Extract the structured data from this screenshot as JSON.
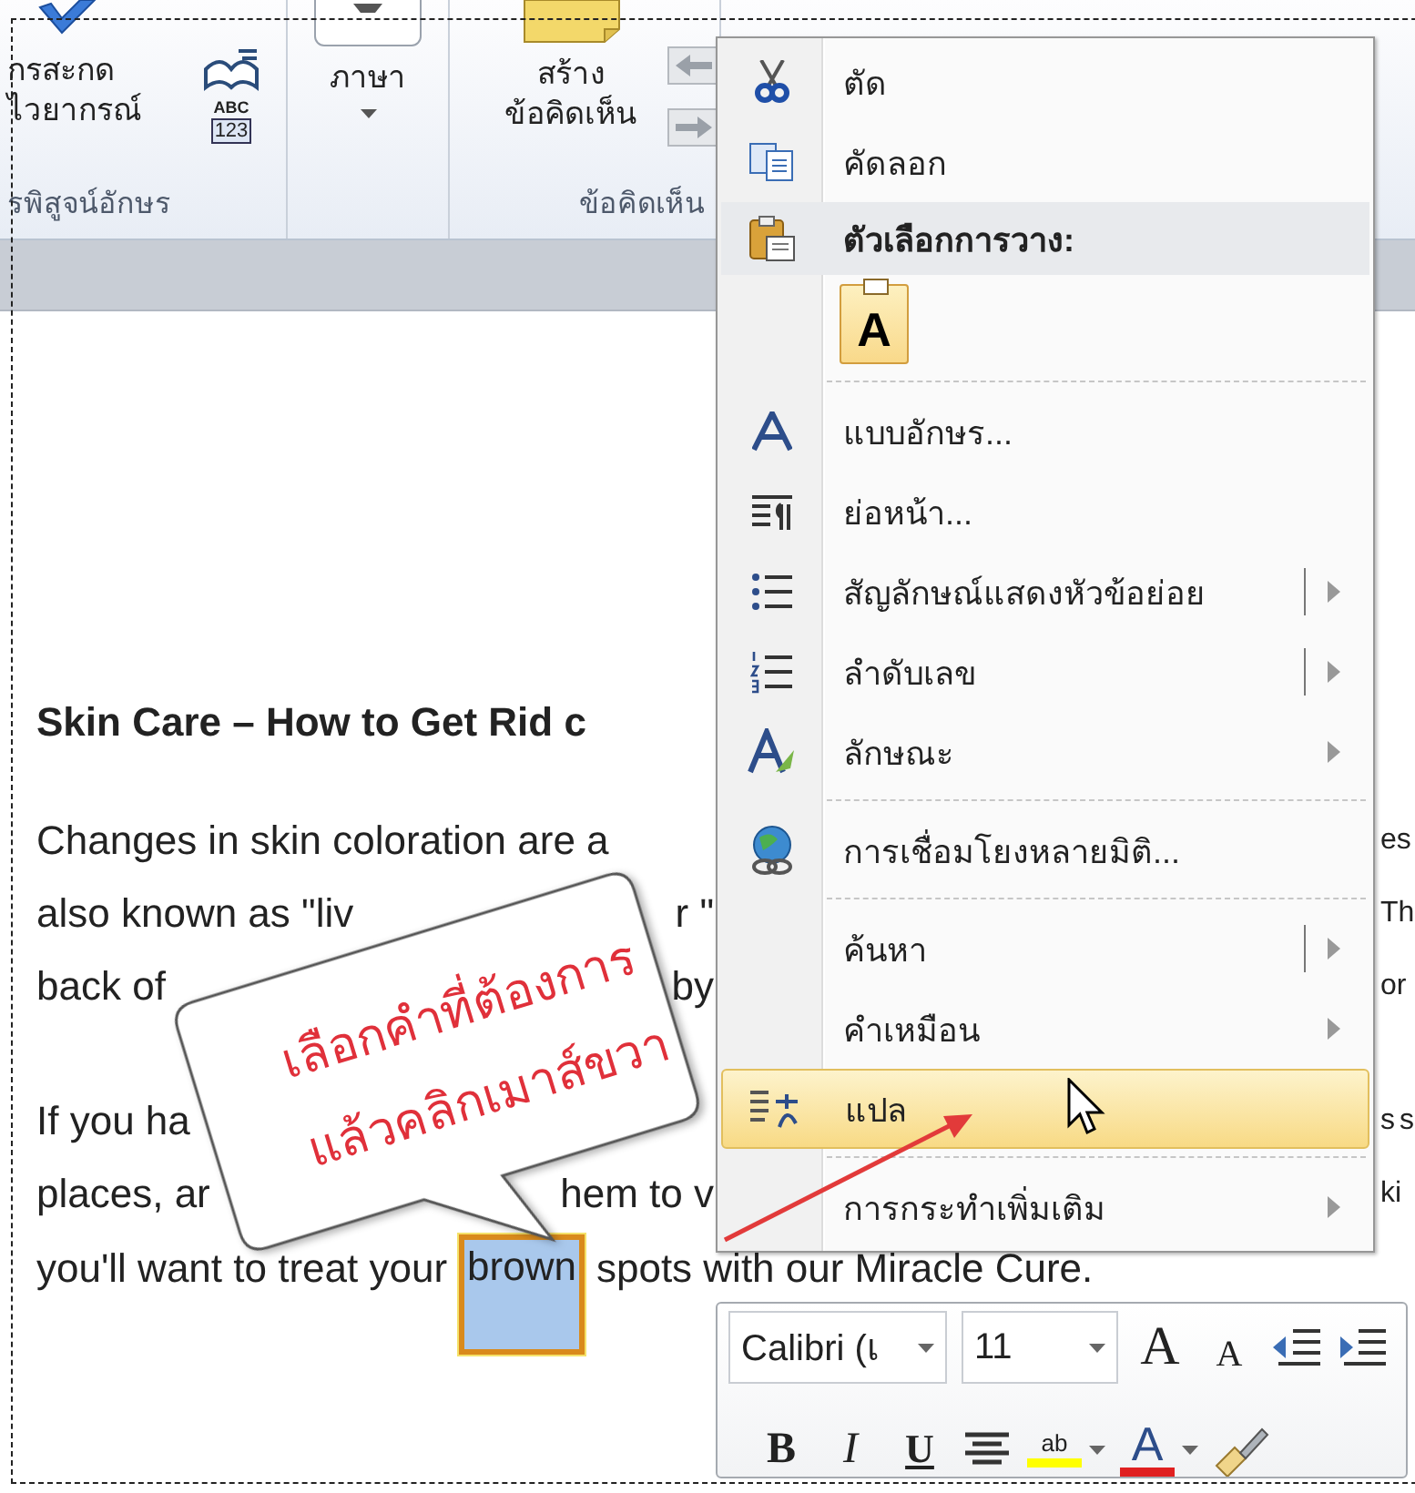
{
  "ribbon": {
    "groups": [
      {
        "label": "รพิสูจน์อักษร",
        "buttons": [
          {
            "kind": "large",
            "lines": [
              "กรสะกด",
              "ไวยากรณ์"
            ]
          },
          {
            "kind": "word_count",
            "lines": [
              "ABC",
              "123"
            ]
          }
        ]
      },
      {
        "buttons": [
          {
            "kind": "dropdown",
            "lines": [
              "ภาษา"
            ]
          }
        ]
      },
      {
        "label": "ข้อคิดเห็น",
        "buttons": [
          {
            "kind": "large",
            "lines": [
              "สร้าง",
              "ข้อคิดเห็น"
            ]
          },
          {
            "kind": "nav"
          }
        ]
      }
    ]
  },
  "document": {
    "heading": "Skin Care – How to Get Rid c",
    "paragraphs": [
      [
        {
          "kind": "cut",
          "left": "Changes in skin coloration are a",
          "right": "es"
        },
        {
          "kind": "cut",
          "left": "also known as \"liv",
          "middle": "r \"",
          "right": "Th"
        },
        {
          "kind": "cut",
          "left": "back of",
          "middle": "by",
          "right": "or"
        }
      ],
      [
        {
          "kind": "cut",
          "left": "If you ha",
          "right": "s s"
        },
        {
          "kind": "cut",
          "left": "places, ar",
          "middle": "hem to v",
          "right": "ki"
        },
        {
          "kind": "full",
          "segments": [
            {
              "text": "you'll want to treat your",
              "selected": false
            },
            {
              "text": "brown",
              "selected": true
            },
            {
              "text": "spots with our Miracle Cure.",
              "selected": false
            }
          ]
        }
      ]
    ]
  },
  "context_menu": [
    {
      "kind": "item",
      "label": "ตัด",
      "selected": false
    },
    {
      "kind": "item",
      "label": "คัดลอก",
      "selected": false
    },
    {
      "kind": "header",
      "label": "ตัวเลือกการวาง:"
    },
    {
      "kind": "paste_option",
      "label": "A"
    },
    {
      "kind": "separator"
    },
    {
      "kind": "item",
      "label": "แบบอักษร...",
      "selected": false
    },
    {
      "kind": "item",
      "label": "ย่อหน้า...",
      "selected": false
    },
    {
      "kind": "item",
      "label": "สัญลักษณ์แสดงหัวข้อย่อย",
      "submenu": true,
      "split": true,
      "selected": false
    },
    {
      "kind": "item",
      "label": "ลำดับเลข",
      "submenu": true,
      "split": true,
      "selected": false
    },
    {
      "kind": "item",
      "label": "ลักษณะ",
      "submenu": true,
      "selected": false
    },
    {
      "kind": "separator"
    },
    {
      "kind": "item",
      "label": "การเชื่อมโยงหลายมิติ...",
      "selected": false
    },
    {
      "kind": "separator"
    },
    {
      "kind": "item",
      "label": "ค้นหา",
      "submenu": true,
      "split": true,
      "selected": false
    },
    {
      "kind": "item",
      "label": "คำเหมือน",
      "submenu": true,
      "selected": false
    },
    {
      "kind": "item",
      "label": "แปล",
      "selected": true
    },
    {
      "kind": "separator"
    },
    {
      "kind": "item",
      "label": "การกระทำเพิ่มเติม",
      "submenu": true,
      "selected": false
    }
  ],
  "mini_toolbar": {
    "controls": [
      {
        "kind": "combo",
        "text": "Calibri (เ"
      },
      {
        "kind": "combo",
        "text": "11"
      },
      {
        "kind": "grow",
        "text": "A"
      },
      {
        "kind": "shrink",
        "text": "A"
      },
      {
        "kind": "outdent"
      },
      {
        "kind": "indent"
      },
      {
        "kind": "bold",
        "text": "B"
      },
      {
        "kind": "italic",
        "text": "I"
      },
      {
        "kind": "underline",
        "text": "U"
      },
      {
        "kind": "center"
      },
      {
        "kind": "highlight",
        "text": "ab",
        "color": "#ffff00"
      },
      {
        "kind": "font_color",
        "text": "A",
        "color": "#e02020"
      },
      {
        "kind": "painter"
      }
    ]
  },
  "callout": {
    "lines": [
      "เลือกคำที่ต้องการ",
      "แล้วคลิกเมาส์ขวา"
    ]
  }
}
